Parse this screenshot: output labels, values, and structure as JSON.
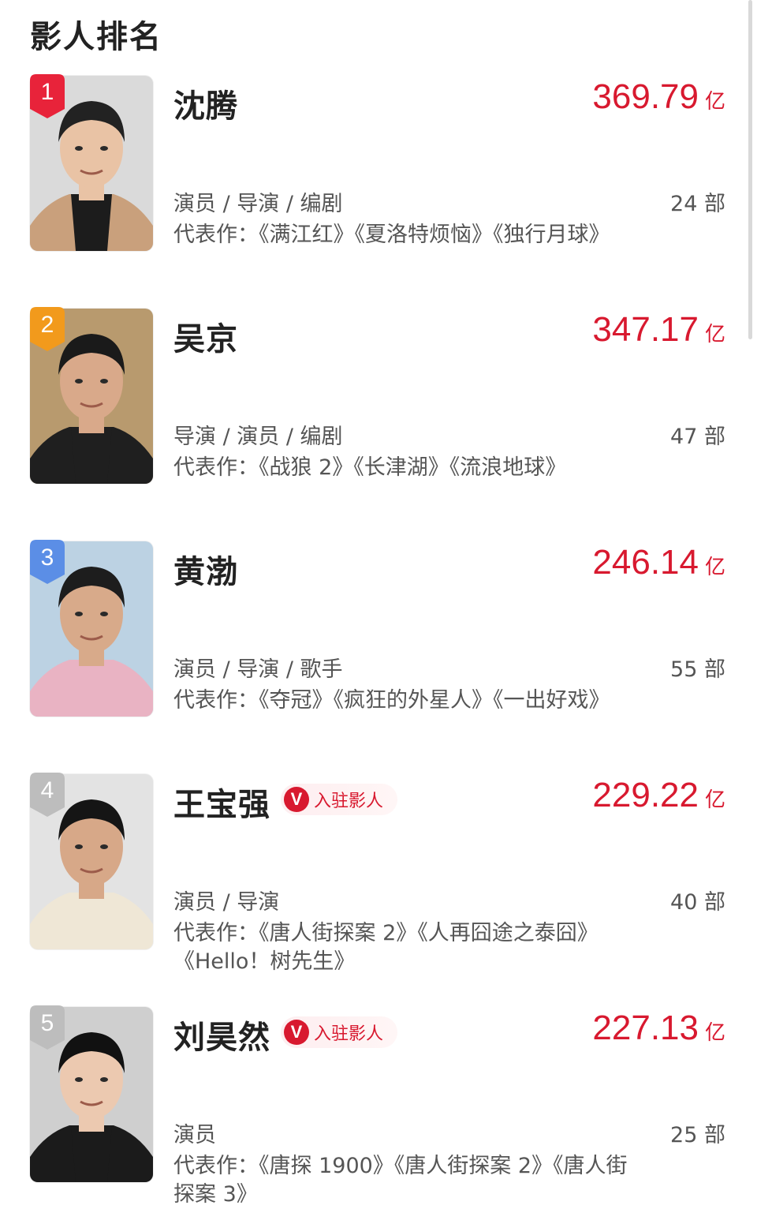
{
  "page": {
    "title": "影人排名"
  },
  "labels": {
    "works_prefix": "代表作：",
    "verified_tag": "入驻影人",
    "verified_icon": "V"
  },
  "colors": {
    "accent": "#d8192f",
    "rank1": "#e8233a",
    "rank2": "#f29a1c",
    "rank3": "#5b8ee6",
    "rank_other": "#bdbdbd"
  },
  "people": [
    {
      "rank": "1",
      "name": "沈腾",
      "verified": false,
      "box_office": "369.79",
      "unit": "亿",
      "roles": "演员 / 导演 / 编剧",
      "count": "24 部",
      "works": "《满江红》《夏洛特烦恼》《独行月球》",
      "photo": {
        "bg": "#dadada",
        "jacket": "#c9a07c",
        "inner": "#1c1c1c",
        "skin": "#e9c3a5",
        "hair": "#222"
      }
    },
    {
      "rank": "2",
      "name": "吴京",
      "verified": false,
      "box_office": "347.17",
      "unit": "亿",
      "roles": "导演 / 演员 / 编剧",
      "count": "47 部",
      "works": "《战狼 2》《长津湖》《流浪地球》",
      "photo": {
        "bg": "#b89a6e",
        "jacket": "#1f1f1f",
        "inner": "#1f1f1f",
        "skin": "#d9a98a",
        "hair": "#1a1a1a"
      }
    },
    {
      "rank": "3",
      "name": "黄渤",
      "verified": false,
      "box_office": "246.14",
      "unit": "亿",
      "roles": "演员 / 导演 / 歌手",
      "count": "55 部",
      "works": "《夺冠》《疯狂的外星人》《一出好戏》",
      "photo": {
        "bg": "#bcd2e3",
        "jacket": "#e9b3c3",
        "inner": "#e9b3c3",
        "skin": "#d8aa8a",
        "hair": "#1d1d1d"
      }
    },
    {
      "rank": "4",
      "name": "王宝强",
      "verified": true,
      "box_office": "229.22",
      "unit": "亿",
      "roles": "演员 / 导演",
      "count": "40 部",
      "works": "《唐人街探案 2》《人再囧途之泰囧》《Hello！树先生》",
      "photo": {
        "bg": "#e3e3e3",
        "jacket": "#efe7d6",
        "inner": "#efe7d6",
        "skin": "#d7a888",
        "hair": "#151515"
      }
    },
    {
      "rank": "5",
      "name": "刘昊然",
      "verified": true,
      "box_office": "227.13",
      "unit": "亿",
      "roles": "演员",
      "count": "25 部",
      "works": "《唐探 1900》《唐人街探案 2》《唐人街探案 3》",
      "photo": {
        "bg": "#cfcfcf",
        "jacket": "#1b1b1b",
        "inner": "#1b1b1b",
        "skin": "#ecc9b0",
        "hair": "#111"
      }
    }
  ]
}
